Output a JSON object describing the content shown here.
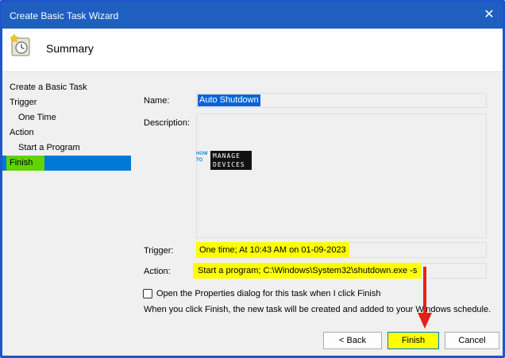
{
  "window": {
    "title": "Create Basic Task Wizard",
    "close_icon": "close-icon"
  },
  "header": {
    "title": "Summary",
    "icon": "task-scheduler-icon"
  },
  "steps": [
    {
      "label": "Create a Basic Task",
      "sub": false,
      "active": false
    },
    {
      "label": "Trigger",
      "sub": false,
      "active": false
    },
    {
      "label": "One Time",
      "sub": true,
      "active": false
    },
    {
      "label": "Action",
      "sub": false,
      "active": false
    },
    {
      "label": "Start a Program",
      "sub": true,
      "active": false
    },
    {
      "label": "Finish",
      "sub": false,
      "active": true
    }
  ],
  "summary": {
    "name_label": "Name:",
    "name_value": "Auto Shutdown",
    "description_label": "Description:",
    "trigger_label": "Trigger:",
    "trigger_value": "One time; At 10:43 AM on 01-09-2023",
    "action_label": "Action:",
    "action_value": "Start a program; C:\\Windows\\System32\\shutdown.exe -s"
  },
  "watermark": {
    "left_line1": "HOW",
    "left_line2": "TO",
    "right_line1": "MANAGE",
    "right_line2": "DEVICES"
  },
  "options": {
    "open_properties_label": "Open the Properties dialog for this task when I click Finish",
    "open_properties_checked": false,
    "info_text": "When you click Finish, the new task will be created and added to your Windows schedule."
  },
  "buttons": {
    "back": "< Back",
    "finish": "Finish",
    "cancel": "Cancel"
  },
  "colors": {
    "titlebar": "#1f5fbf",
    "selection": "#0078d7",
    "highlight": "#ffff00",
    "arrow": "#e8201a"
  }
}
